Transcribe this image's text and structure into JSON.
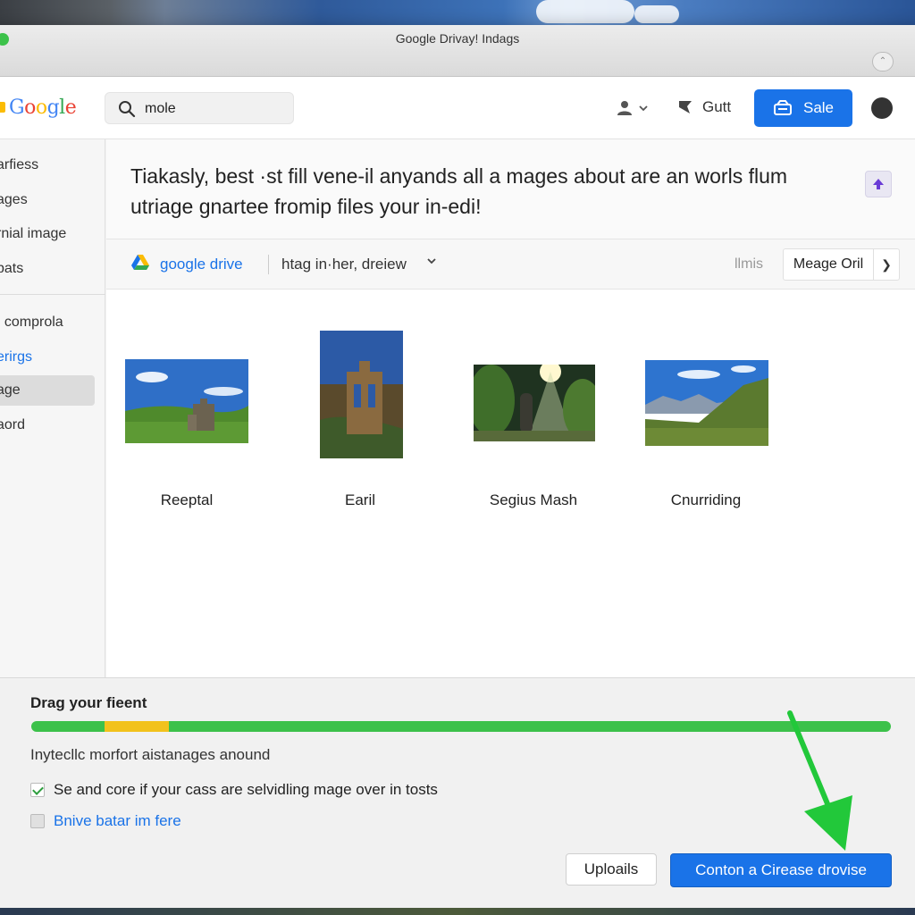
{
  "window": {
    "title": "Google Drivay! Indags"
  },
  "header": {
    "logo": "Google",
    "search": {
      "value": "mole",
      "placeholder": ""
    },
    "user_menu_icon": "account-icon",
    "gutt_label": "Gutt",
    "sale_label": "Sale"
  },
  "sidebar": {
    "items": [
      {
        "label": "arfiess",
        "style": "normal"
      },
      {
        "label": "ages",
        "style": "normal"
      },
      {
        "label": "rnial image",
        "style": "normal"
      },
      {
        "label": "bats",
        "style": "normal"
      },
      {
        "label": ". comprola",
        "style": "normal"
      },
      {
        "label": "erirgs",
        "style": "link"
      },
      {
        "label": "age",
        "style": "active"
      },
      {
        "label": "aord",
        "style": "normal"
      }
    ]
  },
  "banner": {
    "text": "Tiakasly, best ·st fill vene-il anyands all a mages about are an worls flum utriage gnartee fromip files your in-edi!"
  },
  "toolbar": {
    "drive_name": "google drive",
    "filter_label": "htag in·her, dreiew",
    "llmis": "llmis",
    "open_label": "Meage Oril"
  },
  "thumbnails": [
    {
      "label": "Reeptal"
    },
    {
      "label": "Earil"
    },
    {
      "label": "Segius Mash"
    },
    {
      "label": "Cnurriding"
    }
  ],
  "dialog": {
    "title": "Drag your fieent",
    "progress": {
      "green_fraction": 1.0,
      "yellow_segment": [
        0.085,
        0.16
      ]
    },
    "description": "Inytecllc morfort aistanages anound",
    "checkbox1": {
      "label": "Se and core if your cass are selvidling mage over in tosts",
      "checked": true
    },
    "checkbox2": {
      "label": "Bnive batar im fere",
      "checked": false
    },
    "upload_label": "Uploails",
    "primary_label": "Conton a Cirease drovise"
  },
  "colors": {
    "accent": "#1a73e8",
    "progress_green": "#3cc14a",
    "progress_yellow": "#f2c21c",
    "arrow_green": "#22c83a"
  }
}
